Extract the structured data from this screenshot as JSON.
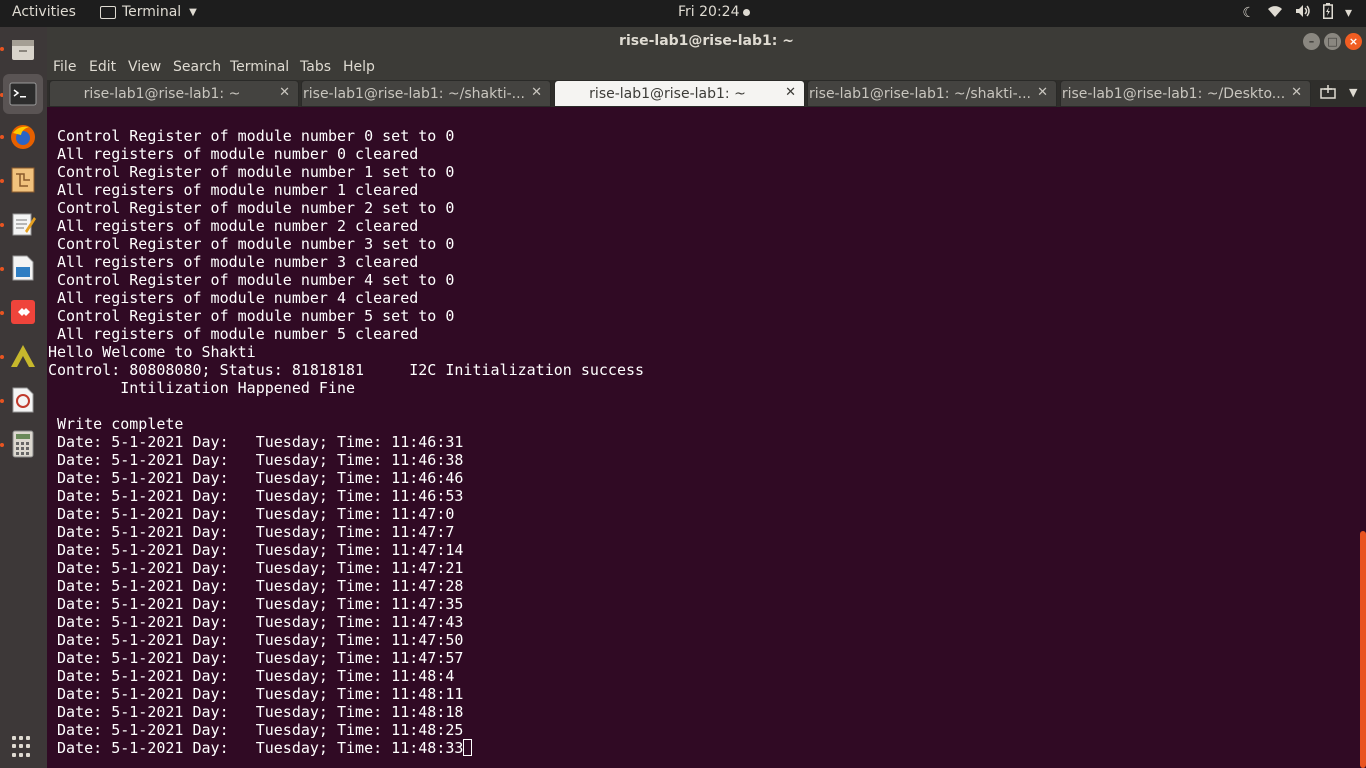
{
  "topbar": {
    "activities": "Activities",
    "app_name": "Terminal",
    "clock": "Fri 20:24",
    "tray_icons": [
      "night-light-icon",
      "wifi-icon",
      "volume-icon",
      "battery-icon",
      "power-menu-icon"
    ]
  },
  "dock": {
    "items": [
      "files-icon",
      "terminal-icon",
      "firefox-icon",
      "blueprint-app-icon",
      "text-editor-icon",
      "document-viewer-icon",
      "anydesk-icon",
      "vivado-icon",
      "eclipse-icon",
      "calculator-icon"
    ],
    "show_apps_icon": "app-grid-icon"
  },
  "window": {
    "title": "rise-lab1@rise-lab1: ~",
    "menu": [
      "File",
      "Edit",
      "View",
      "Search",
      "Terminal",
      "Tabs",
      "Help"
    ],
    "tabs": [
      {
        "label": "rise-lab1@rise-lab1: ~",
        "active": false
      },
      {
        "label": "rise-lab1@rise-lab1: ~/shakti-...",
        "active": false
      },
      {
        "label": "rise-lab1@rise-lab1: ~",
        "active": true
      },
      {
        "label": "rise-lab1@rise-lab1: ~/shakti-...",
        "active": false
      },
      {
        "label": "rise-lab1@rise-lab1: ~/Deskto...",
        "active": false
      }
    ]
  },
  "terminal": {
    "lines": [
      " Control Register of module number 0 set to 0",
      " All registers of module number 0 cleared",
      " Control Register of module number 1 set to 0",
      " All registers of module number 1 cleared",
      " Control Register of module number 2 set to 0",
      " All registers of module number 2 cleared",
      " Control Register of module number 3 set to 0",
      " All registers of module number 3 cleared",
      " Control Register of module number 4 set to 0",
      " All registers of module number 4 cleared",
      " Control Register of module number 5 set to 0",
      " All registers of module number 5 cleared",
      "Hello Welcome to Shakti",
      "Control: 80808080; Status: 81818181     I2C Initialization success",
      "        Intilization Happened Fine",
      "",
      " Write complete",
      " Date: 5-1-2021 Day:   Tuesday; Time: 11:46:31",
      " Date: 5-1-2021 Day:   Tuesday; Time: 11:46:38",
      " Date: 5-1-2021 Day:   Tuesday; Time: 11:46:46",
      " Date: 5-1-2021 Day:   Tuesday; Time: 11:46:53",
      " Date: 5-1-2021 Day:   Tuesday; Time: 11:47:0",
      " Date: 5-1-2021 Day:   Tuesday; Time: 11:47:7",
      " Date: 5-1-2021 Day:   Tuesday; Time: 11:47:14",
      " Date: 5-1-2021 Day:   Tuesday; Time: 11:47:21",
      " Date: 5-1-2021 Day:   Tuesday; Time: 11:47:28",
      " Date: 5-1-2021 Day:   Tuesday; Time: 11:47:35",
      " Date: 5-1-2021 Day:   Tuesday; Time: 11:47:43",
      " Date: 5-1-2021 Day:   Tuesday; Time: 11:47:50",
      " Date: 5-1-2021 Day:   Tuesday; Time: 11:47:57",
      " Date: 5-1-2021 Day:   Tuesday; Time: 11:48:4",
      " Date: 5-1-2021 Day:   Tuesday; Time: 11:48:11",
      " Date: 5-1-2021 Day:   Tuesday; Time: 11:48:18",
      " Date: 5-1-2021 Day:   Tuesday; Time: 11:48:25",
      " Date: 5-1-2021 Day:   Tuesday; Time: 11:48:33"
    ]
  },
  "colors": {
    "terminal_bg": "#300a24",
    "accent": "#e95420",
    "text": "#ffffff"
  }
}
